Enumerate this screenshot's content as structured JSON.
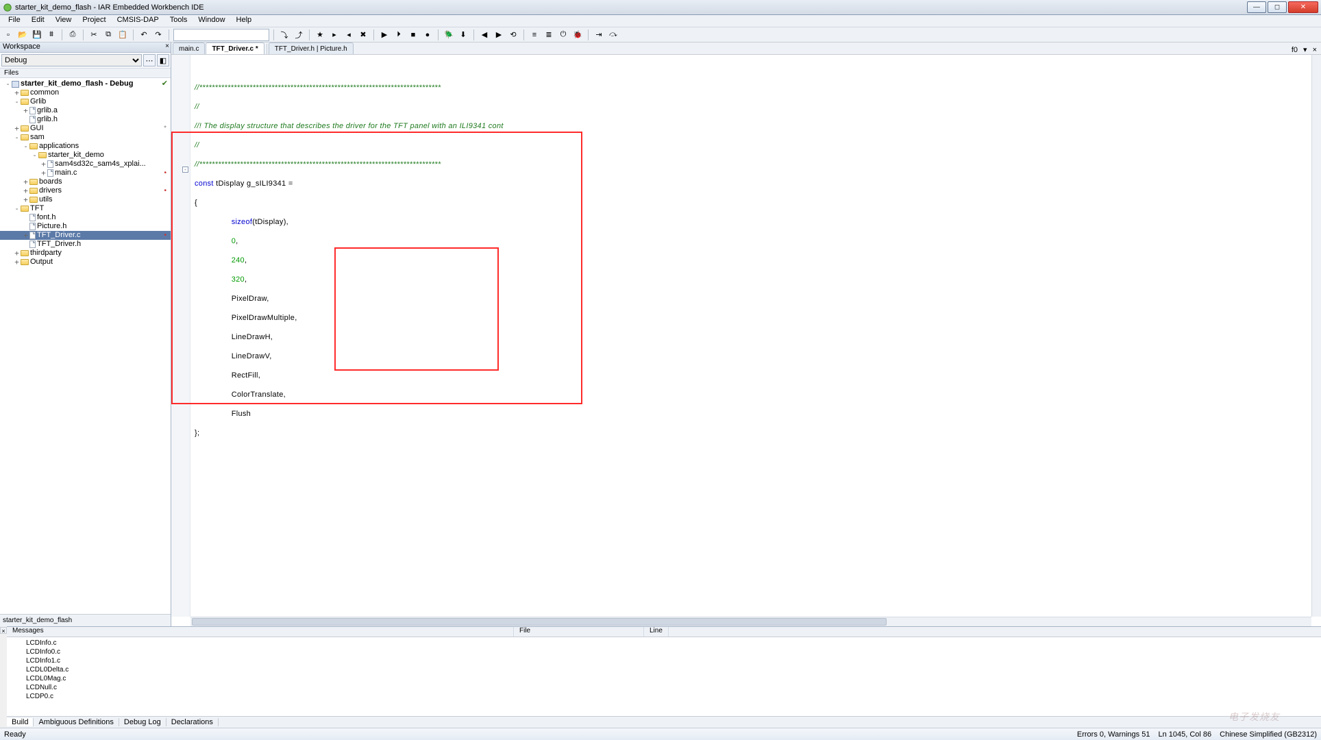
{
  "title": "starter_kit_demo_flash - IAR Embedded Workbench IDE",
  "window_buttons": {
    "min": "—",
    "max": "◻",
    "close": "✕"
  },
  "menu": [
    "File",
    "Edit",
    "View",
    "Project",
    "CMSIS-DAP",
    "Tools",
    "Window",
    "Help"
  ],
  "toolbar_icons": [
    "new-file-icon",
    "open-file-icon",
    "save-icon",
    "save-all-icon",
    "|",
    "print-icon",
    "|",
    "cut-icon",
    "copy-icon",
    "paste-icon",
    "|",
    "undo-icon",
    "redo-icon",
    "|",
    "combo",
    "|",
    "find-next-icon",
    "find-prev-icon",
    "|",
    "bookmark-toggle-icon",
    "bookmark-next-icon",
    "bookmark-prev-icon",
    "bookmark-clear-icon",
    "|",
    "compile-icon",
    "make-icon",
    "stop-build-icon",
    "toggle-bp-icon",
    "|",
    "debug-icon",
    "debug-no-dl-icon",
    "|",
    "nav-back-icon",
    "nav-fwd-icon",
    "restart-icon",
    "|",
    "trace-icon",
    "trace2-icon",
    "power-icon",
    "bug-icon",
    "|",
    "step-into-icon",
    "step-over-icon"
  ],
  "workspace": {
    "panel_title": "Workspace",
    "config": "Debug",
    "files_header": "Files",
    "bottom_tab": "starter_kit_demo_flash"
  },
  "tree": [
    {
      "d": 0,
      "t": "proj",
      "exp": "-",
      "lbl": "starter_kit_demo_flash - Debug",
      "chk": true
    },
    {
      "d": 1,
      "t": "folder",
      "exp": "+",
      "lbl": "common"
    },
    {
      "d": 1,
      "t": "folder",
      "exp": "-",
      "lbl": "Grlib"
    },
    {
      "d": 2,
      "t": "file",
      "exp": "+",
      "lbl": "grlib.a"
    },
    {
      "d": 2,
      "t": "file",
      "exp": "",
      "lbl": "grlib.h"
    },
    {
      "d": 1,
      "t": "folder",
      "exp": "+",
      "lbl": "GUI",
      "markg": "*"
    },
    {
      "d": 1,
      "t": "folder",
      "exp": "-",
      "lbl": "sam"
    },
    {
      "d": 2,
      "t": "folder",
      "exp": "-",
      "lbl": "applications"
    },
    {
      "d": 3,
      "t": "folder",
      "exp": "-",
      "lbl": "starter_kit_demo"
    },
    {
      "d": 4,
      "t": "file",
      "exp": "+",
      "lbl": "sam4sd32c_sam4s_xplai..."
    },
    {
      "d": 4,
      "t": "file",
      "exp": "+",
      "lbl": "main.c",
      "mark": "•"
    },
    {
      "d": 2,
      "t": "folder",
      "exp": "+",
      "lbl": "boards"
    },
    {
      "d": 2,
      "t": "folder",
      "exp": "+",
      "lbl": "drivers",
      "mark": "•"
    },
    {
      "d": 2,
      "t": "folder",
      "exp": "+",
      "lbl": "utils"
    },
    {
      "d": 1,
      "t": "folder",
      "exp": "-",
      "lbl": "TFT"
    },
    {
      "d": 2,
      "t": "file",
      "exp": "",
      "lbl": "font.h"
    },
    {
      "d": 2,
      "t": "file",
      "exp": "",
      "lbl": "Picture.h"
    },
    {
      "d": 2,
      "t": "file",
      "exp": "+",
      "lbl": "TFT_Driver.c",
      "sel": true,
      "mark": "•"
    },
    {
      "d": 2,
      "t": "file",
      "exp": "",
      "lbl": "TFT_Driver.h"
    },
    {
      "d": 1,
      "t": "folder",
      "exp": "+",
      "lbl": "thirdparty"
    },
    {
      "d": 1,
      "t": "folder",
      "exp": "+",
      "lbl": "Output"
    }
  ],
  "tabs": {
    "items": [
      {
        "label": "main.c",
        "active": false
      },
      {
        "label": "TFT_Driver.c *",
        "active": true
      },
      {
        "label": "TFT_Driver.h | Picture.h",
        "active": false
      }
    ],
    "right_label": "f0"
  },
  "code": {
    "l1": "//*****************************************************************************",
    "l2": "//",
    "l3a": "//! ",
    "l3b": "The display structure that describes the driver for the TFT panel with an ILI9341",
    "l3c": " cont",
    "l4": "//",
    "l5": "//*****************************************************************************",
    "l6a": "const",
    "l6b": " tDisplay g_sILI9341 =",
    "l7": "{",
    "l8a": "                sizeof",
    "l8b": "(tDisplay),",
    "l9": "                0",
    "l9b": ",",
    "l10": "                240",
    "l10b": ",",
    "l11": "                320",
    "l11b": ",",
    "l12": "                PixelDraw,",
    "l13": "                PixelDrawMultiple,",
    "l14": "                LineDrawH,",
    "l15": "                LineDrawV,",
    "l16": "                RectFill,",
    "l17": "                ColorTranslate,",
    "l18": "                Flush",
    "l19": "};"
  },
  "output": {
    "columns": {
      "messages": "Messages",
      "file": "File",
      "line": "Line"
    },
    "rows": [
      "LCDInfo.c",
      "LCDInfo0.c",
      "LCDInfo1.c",
      "LCDL0Delta.c",
      "LCDL0Mag.c",
      "LCDNull.c",
      "LCDP0.c"
    ],
    "tabs": [
      "Build",
      "Ambiguous Definitions",
      "Debug Log",
      "Declarations"
    ],
    "active_tab": 0
  },
  "status": {
    "ready": "Ready",
    "errors": "Errors 0, Warnings 51",
    "pos": "Ln 1045, Col 86",
    "enc": "Chinese Simplified (GB2312)"
  },
  "watermark": "电子发烧友"
}
